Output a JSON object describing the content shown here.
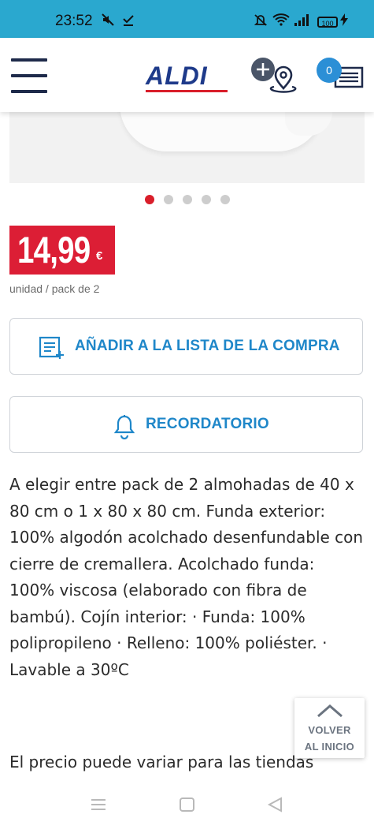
{
  "status_bar": {
    "time": "23:52",
    "battery": "100",
    "icons": [
      "mute-icon",
      "download-done-icon",
      "dnd-icon",
      "wifi-icon",
      "signal-icon",
      "battery-icon",
      "charging-icon"
    ]
  },
  "header": {
    "logo": "ALDI",
    "cart_count": "0",
    "icons": [
      "menu-icon",
      "store-location-icon",
      "shopping-list-icon"
    ]
  },
  "carousel": {
    "total_dots": 5,
    "active_index": 0
  },
  "price": {
    "value": "14,99",
    "currency": "€",
    "unit": "unidad / pack de 2"
  },
  "actions": {
    "add_to_list_label": "AÑADIR A LA LISTA DE LA COMPRA",
    "reminder_label": "RECORDATORIO"
  },
  "description": {
    "text": "A elegir entre pack de 2 almohadas de 40 x 80 cm o 1 x 80 x 80 cm. Funda exterior: 100% algodón acolchado desenfundable con cierre de cremallera. Acolchado funda: 100% viscosa (elaborado con fibra de bambú). Cojín interior: · Funda: 100% polipropileno · Relleno: 100% poliéster. · Lavable a 30ºC"
  },
  "price_note": "El precio puede variar para las tiendas",
  "back_to_top": {
    "line1": "VOLVER",
    "line2": "AL INICIO"
  },
  "colors": {
    "status_bar": "#2aa8cf",
    "brand_blue": "#1e3a8a",
    "price_red": "#dc1e35",
    "accent_blue": "#1f87c9"
  }
}
